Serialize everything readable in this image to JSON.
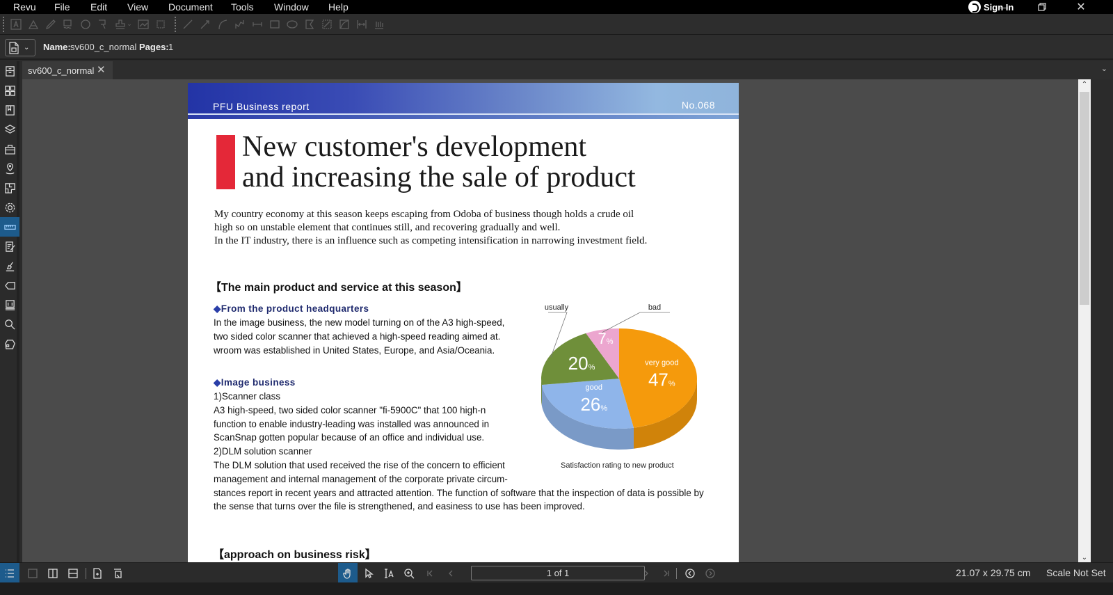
{
  "app": {
    "menu": [
      "Revu",
      "File",
      "Edit",
      "View",
      "Document",
      "Tools",
      "Window",
      "Help"
    ],
    "sign_in_label": "Sign In",
    "window_controls": [
      "minimize",
      "restore",
      "close"
    ]
  },
  "toolbar": {
    "tools": [
      "text-box",
      "highlight",
      "pen",
      "cloud-callout",
      "polygon-cloud",
      "callout",
      "stamp",
      "image",
      "crop",
      "line",
      "arrow",
      "arc",
      "polyline",
      "dimension",
      "rectangle",
      "ellipse",
      "polygon",
      "area-measure",
      "perimeter",
      "length-measure",
      "count"
    ]
  },
  "properties": {
    "name_label": "Name:",
    "name_value": "sv600_c_normal",
    "pages_label": "Pages:",
    "pages_value": "1"
  },
  "left_panel": {
    "icons": [
      "file-access",
      "thumbnails",
      "bookmarks",
      "layers",
      "toolchest",
      "places",
      "spaces",
      "properties",
      "measurements",
      "markups-list",
      "signatures",
      "tags",
      "sets",
      "search",
      "studio"
    ],
    "active": "measurements"
  },
  "tabs": [
    {
      "label": "sv600_c_normal",
      "active": true
    }
  ],
  "document": {
    "header_left": "PFU Business report",
    "header_right": "No.068",
    "title_line1": "New customer's development",
    "title_line2": "and increasing the sale of product",
    "intro": [
      "My country economy at this season keeps escaping from Odoba of business though holds a crude oil",
      "high so on unstable element that continues still, and recovering gradually and well.",
      "In the IT industry, there is an influence such as competing intensification in narrowing investment field."
    ],
    "section1_heading": "【The main product and service at this season】",
    "sub1": "From the product headquarters",
    "sub1_text": [
      "In the image business, the new model turning on of the A3 high-speed,",
      "two sided color scanner that achieved a high-speed reading aimed at.",
      "wroom was established in United States, Europe, and Asia/Oceania."
    ],
    "sub2": "Image business",
    "sub2_text": [
      "1)Scanner class",
      "A3 high-speed, two sided color scanner \"fi-5900C\" that 100 high-n",
      "function to enable industry-leading was installed was announced in",
      "ScanSnap gotten popular because of an office and individual use.",
      "2)DLM solution scanner",
      "The DLM solution that used received the rise of the concern to efficient",
      "management and internal management of the corporate private circum-",
      "stances report in recent years and attracted attention. The function of software that the inspection of data is possible by",
      "the sense that turns over the file is strengthened, and easiness to use has been improved."
    ],
    "section2_heading": "【approach on business risk】",
    "diamond": "◆"
  },
  "chart_data": {
    "type": "pie",
    "title": "Satisfaction rating to new product",
    "categories": [
      "very good",
      "good",
      "usually",
      "bad"
    ],
    "values": [
      47,
      26,
      20,
      7
    ],
    "unit": "%",
    "colors": [
      "#f59a0c",
      "#8fb5ea",
      "#6f8f3a",
      "#eca6cf"
    ],
    "labels_inside": {
      "very good": true,
      "good": true,
      "usually": false,
      "bad": false
    },
    "callouts": [
      "usually",
      "bad"
    ]
  },
  "statusbar": {
    "page_indicator": "1 of 1",
    "dimensions": "21.07 x 29.75 cm",
    "scale": "Scale Not Set",
    "active_tool": "pan"
  },
  "colors": {
    "accent": "#1d5b8c",
    "title_bar_red": "#e42838",
    "subheading_blue": "#1f2a6e"
  }
}
